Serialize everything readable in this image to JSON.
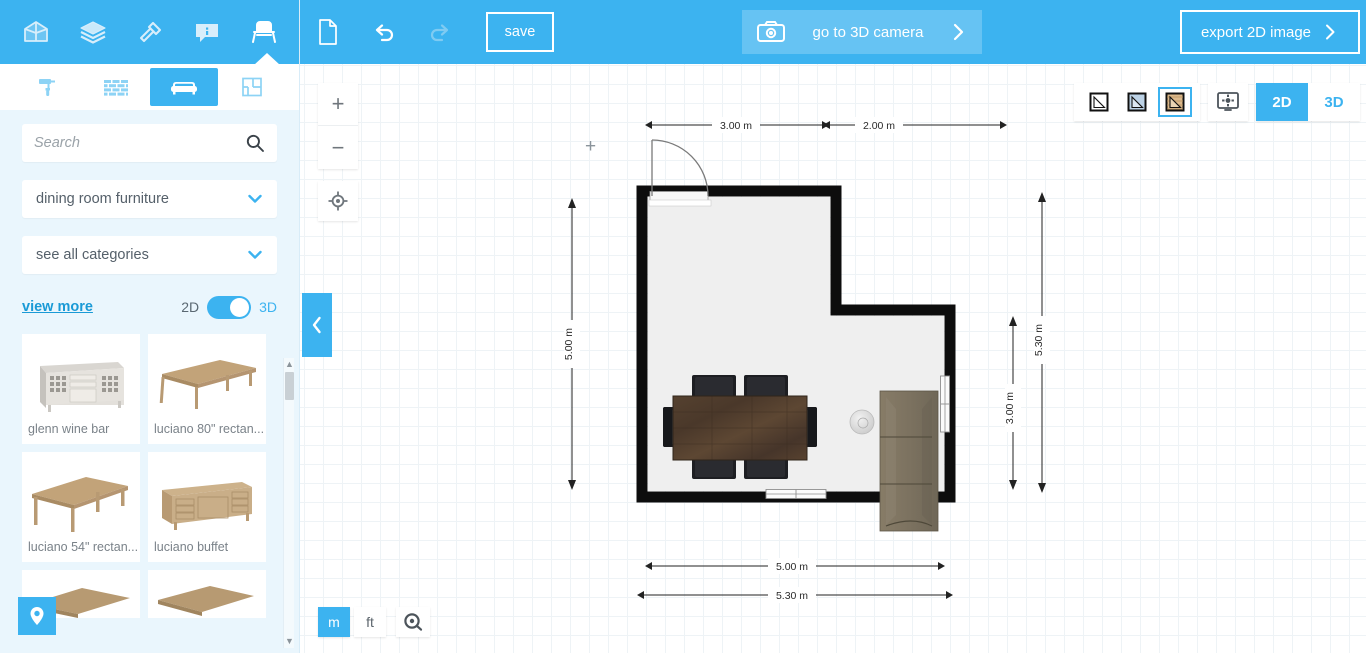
{
  "app": {
    "accent": "#3cb3f0",
    "panel_bg": "#eaf6fd"
  },
  "top_icon_bar": {
    "items": [
      {
        "name": "house-3d-icon",
        "label": "build"
      },
      {
        "name": "layers-icon",
        "label": "floors"
      },
      {
        "name": "hammer-icon",
        "label": "construct"
      },
      {
        "name": "info-chat-icon",
        "label": "info"
      },
      {
        "name": "furniture-chair-icon",
        "label": "furnish"
      }
    ]
  },
  "sub_tabs": {
    "items": [
      {
        "name": "paint-roller-icon",
        "label": "paint",
        "active": false
      },
      {
        "name": "brick-wall-icon",
        "label": "materials",
        "active": false
      },
      {
        "name": "sofa-icon",
        "label": "furniture",
        "active": true
      },
      {
        "name": "floorplan-icon",
        "label": "layouts",
        "active": false
      }
    ]
  },
  "search": {
    "placeholder": "Search",
    "value": ""
  },
  "dropdowns": [
    {
      "label": "dining room furniture"
    },
    {
      "label": "see all categories"
    }
  ],
  "view_more": {
    "link_label": "view more",
    "toggle_left": "2D",
    "toggle_right": "3D",
    "toggle_state": "3D"
  },
  "catalog": {
    "items": [
      {
        "label": "glenn wine bar",
        "art": "sideboard"
      },
      {
        "label": "luciano 80\" rectan...",
        "art": "table"
      },
      {
        "label": "luciano 54\" rectan...",
        "art": "table"
      },
      {
        "label": "luciano buffet",
        "art": "buffet"
      },
      {
        "label": "",
        "art": "table-partial"
      },
      {
        "label": "",
        "art": "table-partial"
      }
    ]
  },
  "pin_button": {
    "name": "location-pin-icon",
    "label": "location"
  },
  "collapse_handle": {
    "name": "chevron-left-icon",
    "label": "collapse panel"
  },
  "toolbar": {
    "new_icon": "new-document-icon",
    "undo_icon": "undo-icon",
    "redo_icon": "redo-icon",
    "save_label": "save",
    "camera_label": "go to 3D camera",
    "camera_icon": "camera-icon",
    "export_label": "export 2D image"
  },
  "canvas_controls": {
    "zoom_in": "+",
    "zoom_out": "−",
    "center_icon": "crosshair-target-icon",
    "plus_marker": "+",
    "style_buttons": [
      {
        "name": "style-outline-icon",
        "active": false
      },
      {
        "name": "style-shaded-icon",
        "active": false
      },
      {
        "name": "style-textured-icon",
        "active": true
      }
    ],
    "gear_icon": "display-settings-gear-icon",
    "dimension_modes": [
      {
        "label": "2D",
        "active": true
      },
      {
        "label": "3D",
        "active": false
      }
    ],
    "units": [
      {
        "label": "m",
        "active": true
      },
      {
        "label": "ft",
        "active": false
      }
    ],
    "tape_icon": "tape-measure-icon"
  },
  "floorplan": {
    "dimensions": {
      "top_left": "3.00 m",
      "top_right": "2.00 m",
      "left": "5.00 m",
      "right_inner": "3.00 m",
      "right_outer": "5.30 m",
      "bottom_inner": "5.00 m",
      "bottom_outer": "5.30 m"
    },
    "objects": [
      {
        "name": "dining-table",
        "type": "table"
      },
      {
        "name": "dining-chairs",
        "type": "chairs",
        "count": 6
      },
      {
        "name": "sofa",
        "type": "sofa"
      },
      {
        "name": "floor-lamp",
        "type": "lamp"
      },
      {
        "name": "entry-door",
        "type": "door"
      },
      {
        "name": "bottom-window",
        "type": "window"
      },
      {
        "name": "right-window",
        "type": "window"
      }
    ],
    "colors": {
      "wall": "#0d0d0d",
      "floor": "#efefef",
      "table": "#4f3d31",
      "chair": "#1b1c20",
      "sofa": "#7e7460"
    }
  }
}
